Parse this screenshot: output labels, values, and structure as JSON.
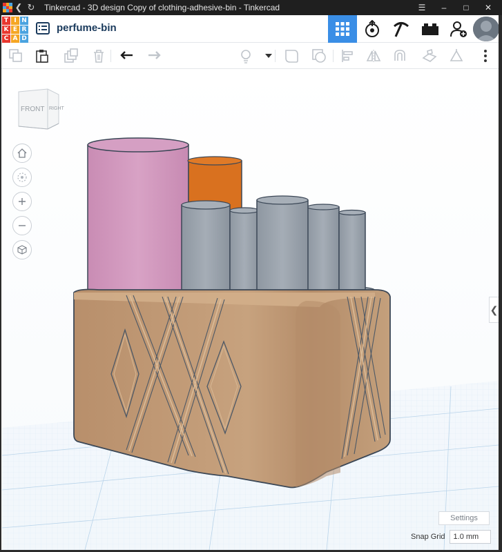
{
  "window": {
    "title": "Tinkercad - 3D design Copy of clothing-adhesive-bin - Tinkercad",
    "controls": [
      "menu-icon",
      "minimize-icon",
      "maximize-icon",
      "close-icon"
    ]
  },
  "header": {
    "logo_letters": [
      "T",
      "I",
      "N",
      "K",
      "E",
      "R",
      "C",
      "A",
      "D"
    ],
    "logo_colors": [
      "#e8372e",
      "#f5a623",
      "#4aa3df",
      "#e8372e",
      "#f5a623",
      "#4aa3df",
      "#e8372e",
      "#f5a623",
      "#4aa3df"
    ],
    "design_name": "perfume-bin",
    "view_buttons": [
      "3d-view-icon",
      "codeblocks-icon",
      "pickaxe-icon",
      "brick-icon",
      "add-user-icon"
    ],
    "active_color": "#3a8ee6"
  },
  "toolbar": {
    "left_tools": [
      "copy-icon",
      "paste-icon",
      "duplicate-icon",
      "delete-icon",
      "undo-icon",
      "redo-icon"
    ],
    "right_tools": [
      "light-bulb-icon",
      "dropdown-icon",
      "solid-shape-icon",
      "hole-shape-icon",
      "align-icon",
      "mirror-icon",
      "magnet-icon",
      "workplane-icon",
      "ruler-icon",
      "more-icon"
    ]
  },
  "viewcube": {
    "front": "FRONT",
    "right": "RIGHT"
  },
  "nav_controls": [
    "home-view-icon",
    "fit-all-icon",
    "zoom-in-icon",
    "zoom-out-icon",
    "perspective-icon"
  ],
  "settings_label": "Settings",
  "snap": {
    "label": "Snap Grid",
    "value": "1.0 mm"
  },
  "scene_colors": {
    "bin": "#c8a27e",
    "bin_dark": "#b8916c",
    "cylinder_pink": "#d49bc0",
    "cylinder_orange": "#d9711f",
    "cylinder_gray": "#9aa3ad",
    "grid": "#cfe3f3"
  }
}
